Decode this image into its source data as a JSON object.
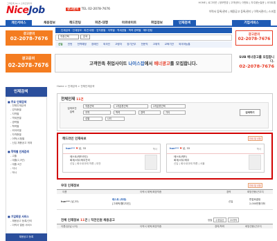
{
  "header": {
    "logo_sub": "고객만족 No.1 스마트일자리",
    "logo_a": "Nice",
    "logo_b": "Job",
    "ad_label": "광고문의",
    "ad_phone": "TEL 02-2078-7676",
    "top_links": "HOME | 로그아웃 | 정보변경 | 고객센터 | 이벤트 | 자주묻는질문 | 사이트맵",
    "sub_links": "이력서 등록/관리 | 채용공고 등록/관리 | 이력서관리 | 스크랩"
  },
  "mainnav": [
    "개인서비스",
    "채용정보",
    "헤드헌팅",
    "파견·대행",
    "아르바이트",
    "취업정보",
    "인재검색",
    "기업서비스"
  ],
  "subnav1": "인재검색 · 인재정보 · 파견·대행 · 업직종별 · 지역별 · 역세권별 · 학력·경력별 · 헤드헌팅",
  "search": {
    "placeholder": "직종선택",
    "go": "검색"
  },
  "subnav3": [
    "신입",
    "인턴",
    "전역예정",
    "장애인",
    "외국인",
    "고령자",
    "장기근무",
    "전문직",
    "고위직",
    "교육기관",
    "외국어능통"
  ],
  "ads": {
    "left_a": "광고문의",
    "left_b": "02-2078-7676",
    "right_a": "광고문의",
    "right_b": "02-2078-7676"
  },
  "banner": {
    "left_a": "광고문의",
    "left_b": "02-2078-7676",
    "mid_pre": "고객만족 취업사이트 ",
    "mid_nice": "나이스잡",
    "mid_in": "에서 ",
    "mid_ad": "배너광고",
    "mid_post": "를 모집합니다.",
    "right_a": "SUB 배너광고를 모집합니다.",
    "right_b": "02-2078-7676"
  },
  "leftmenu": {
    "title": "인재검색",
    "sections": [
      {
        "label": "■ 주요 인재검색",
        "items": [
          "- 전체인재검색",
          "- 업직종별",
          "- 지역별",
          "- 역세권별",
          "- 경력별",
          "- 학력별",
          "- 외국어별",
          "- 자격증별",
          "- 어학/시험별",
          "- 신입 채용공고 게재"
        ]
      },
      {
        "label": "■ 학력별 인재검색",
        "items": [
          "- 고졸",
          "- 대졸(2,3년)",
          "- 대졸 4년",
          "- 석사",
          "- 박사"
        ]
      },
      {
        "label": "■ 기업회원 서비스",
        "items": [
          "- 채용공고 등록/관리",
          "- 이력서 열람 서비스"
        ]
      }
    ],
    "bottom": "채용공고 등록"
  },
  "breadcrumb": "Home > 인재검색 > 전체인재검색",
  "searchpanel": {
    "title": "전체인재",
    "count": "11건",
    "label": "검색조건 입력",
    "selects": [
      "직종선택",
      "1차분류선택",
      "2차분류선택",
      "지역",
      "학력",
      "경력",
      "기타",
      "성별",
      "나이"
    ],
    "button": "검색하기"
  },
  "headline": {
    "title": "헤드라인 인재속보",
    "guide": "안내 및 신청",
    "cards": [
      {
        "name": "hun***",
        "meta": "남, 33",
        "tag": "학사",
        "l1": "테스트(헤드라인)",
        "l2": "회계/사무/재무관리",
        "l3": "신입 | 회사내규에 따름 | 대전"
      },
      {
        "name": "hun***",
        "meta": "남, 33",
        "tag": "학사",
        "l1": "테스트(헤드)",
        "l2": "회계/사무/재무",
        "l3": "신입 | 회사내규에 따름 | 서울"
      }
    ]
  },
  "udae": {
    "title": "우대 인재정보",
    "guide": "안내 및 신청",
    "headers": [
      "이름",
      "이력서 제목/희망직종",
      "경력",
      "희망연봉/근무지"
    ],
    "row": {
      "name": "hun***",
      "meta": "(남,33)",
      "title": "테스트 (우대)",
      "sub": "[그래픽/웹디자인]",
      "career": "신입",
      "salary": "면접후결정",
      "salary2": "2,000만원이하"
    }
  },
  "all": {
    "title": "전체 인재정보",
    "count": "11",
    "suffix": "건 | 직전인원 채용공고",
    "sort_label": "정렬",
    "sort": "수정일순",
    "per": "20개씩",
    "headers": [
      "이름(성/남,나이)",
      "이력서 제목/희망직종",
      "경력/학력",
      "희망연봉/근무지"
    ]
  }
}
